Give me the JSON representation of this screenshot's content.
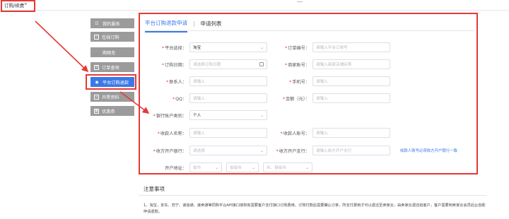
{
  "topbar": {
    "tab_label": "订购/续费",
    "tab_marker": "×"
  },
  "sidebar": {
    "items": [
      {
        "label": "我的服务",
        "icon": "user-group-icon"
      },
      {
        "label": "在线订购",
        "icon": "box-icon"
      },
      {
        "label": "购物车",
        "icon": "cart-icon"
      },
      {
        "label": "订单查询",
        "icon": "list-icon"
      },
      {
        "label": "平台订购退款",
        "icon": "refund-icon"
      },
      {
        "label": "开票资料",
        "icon": "document-icon"
      },
      {
        "label": "优惠券",
        "icon": "coupon-icon"
      }
    ],
    "active_index": 4
  },
  "tabs": {
    "active": "平台订购退款申请",
    "separator": "|",
    "other": "申请列表"
  },
  "form": {
    "platform": {
      "label": "平台选择：",
      "value": "淘宝"
    },
    "order_no": {
      "label": "订单编号：",
      "placeholder": "请输入平台订单号"
    },
    "order_date": {
      "label": "订购日期：",
      "placeholder": "请选择订购日期"
    },
    "shop_account": {
      "label": "商家账号：",
      "placeholder": "请输入商家店铺名称"
    },
    "contact": {
      "label": "联系人：",
      "placeholder": "请输入"
    },
    "phone": {
      "label": "手机号：",
      "placeholder": "请输入"
    },
    "qq": {
      "label": "QQ：",
      "placeholder": "请输入"
    },
    "amount": {
      "label": "金额（元）：",
      "placeholder": "请输入"
    },
    "bank_type": {
      "label": "银行账户类别：",
      "value": "个人"
    },
    "payee_name": {
      "label": "收款人名称：",
      "placeholder": "请输入"
    },
    "payee_account": {
      "label": "收款人账号：",
      "placeholder": "请输入"
    },
    "payee_bank": {
      "label": "收方开户银行：",
      "placeholder": "请选择"
    },
    "payee_branch": {
      "label": "收方开户支行：",
      "placeholder": "请输入收方开户支行"
    },
    "branch_hint": "收款人账号必须收方开户银行一致",
    "address": {
      "label": "开户地址：",
      "province": "省市",
      "city": "省级市",
      "district": "市、县级市"
    }
  },
  "notice": {
    "title": "注意事项",
    "text": "1、淘宝、京东、苏宁、诚信通、速卖通等同购平台API接口授权有需要客户支付接口订购费用，订购付款后需要确认订单，所支付费用才可以退还至卖家云，由卖家云退还给客户，客户需要到卖家云会员后台自助申请退款。"
  },
  "colors": {
    "accent": "#3b78e7",
    "highlight": "#e53935",
    "sidebar_bg": "#9b9b9b"
  }
}
